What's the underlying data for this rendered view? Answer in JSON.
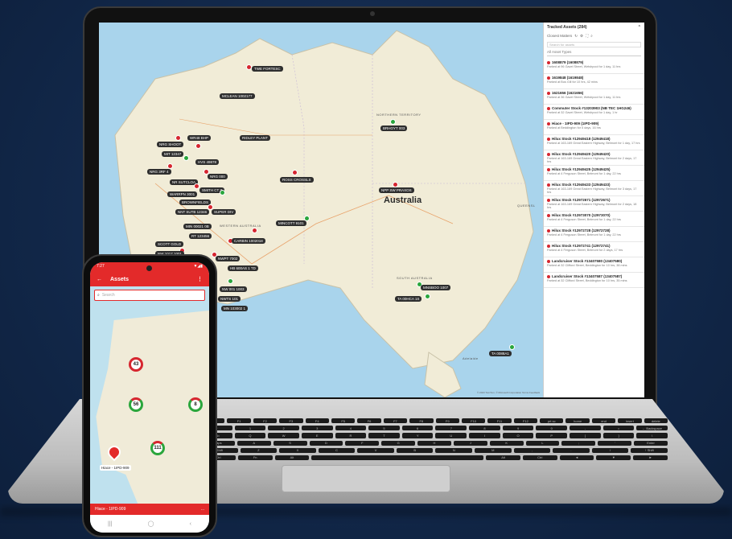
{
  "laptop": {
    "map": {
      "country_label": "Australia",
      "places": [
        {
          "id": "northern-territory",
          "label": "NORTHERN TERRITORY"
        },
        {
          "id": "western-australia",
          "label": "WESTERN AUSTRALIA"
        },
        {
          "id": "south-australia",
          "label": "SOUTH AUSTRALIA"
        },
        {
          "id": "queensland",
          "label": "QUEENSL"
        },
        {
          "id": "adelaide",
          "label": "Adelaide"
        }
      ],
      "cluster_labels": [
        "TWE FORTESC",
        "MCLEAN 1002177",
        "BRHOYT 003",
        "NRG SHOOT",
        "WR48 BHP",
        "MIT 12347",
        "HVS 49878",
        "NRG 3RF 4",
        "NRG 000",
        "NR SUTCLOA",
        "SMITH CT 7",
        "WARRPN 3001",
        "BROWNFIELDS",
        "RIDLEY PLANT",
        "NNT SUTB 12346",
        "SUPER DIV",
        "ROSS CROSSLS",
        "MINCOTT 9101",
        "MIN 00021 0B",
        "RT 123456",
        "CARBIN 1002018",
        "SCOTT GOLD",
        "NW 1017 1001",
        "NWPT 7002",
        "NW 1007",
        "HB 600AS 1 TD",
        "NPP SW PRAXOS",
        "NW 001 1003",
        "NWTS 101",
        "MN 103002 1",
        "MNSBOO 1007",
        "TA 00HCA 1S",
        "TA 0088A1",
        "BG BA 7001",
        "LAVERTON 1",
        "NORTHERNS",
        "CROS DD CHUTE",
        "SN CORLOC 13",
        "SWPT 1",
        "SW ALBION",
        "PERTH ALBANY",
        "EX BASIN ENGIN",
        "SOUTHERN CROSS"
      ],
      "footer": "© 2023 TomTom, © Microsoft Corporation  Terms  Feedback"
    },
    "panel": {
      "title": "Tracked Assets (284)",
      "sort_label": "Closest Matters",
      "search_placeholder": "Search for assets",
      "filter_label": "All Asset Types",
      "assets": [
        {
          "title": "1608879 (1608879)",
          "sub": "Parked at 96 Gavel Street, Welshpool for 1 day, 11 hrs"
        },
        {
          "title": "1619848 (1619848)",
          "sub": "Parked at Bus Gill for 10 hrs, 42 mins"
        },
        {
          "title": "1621656 (1621656)",
          "sub": "Parked at 36 Gavel Street, Welshpool for 1 day, 11 hrs"
        },
        {
          "title": "Commuter Stock #13203903 (NB TEC 1HG246)",
          "sub": "Parked at 32 Gavel Street, Welshpool for 1 day, 1 hr"
        },
        {
          "title": "Hiace - 1IPD-909 (1IPD-909)",
          "sub": "Parked at Beddington for 5 days, 16 hrs"
        },
        {
          "title": "Hilux Stock #12949418 (12949418)",
          "sub": "Parked at 163-169 Great Eastern Highway, Belmont for 1 day, 17 hrs"
        },
        {
          "title": "Hilux Stock #12949420 (12949420)",
          "sub": "Parked at 163-169 Great Eastern Highway, Belmont for 2 days, 17 hrs"
        },
        {
          "title": "Hilux Stock #12949425 (12949425)",
          "sub": "Parked at 4 Ferguson Street, Belmont for 1 day, 22 hrs"
        },
        {
          "title": "Hilux Stock #12949433 (12949433)",
          "sub": "Parked at 163-169 Great Eastern Highway, Belmont for 3 days, 17 hrs"
        },
        {
          "title": "Hilux Stock #12972671 (12972671)",
          "sub": "Parked at 163-169 Great Eastern Highway, Belmont for 2 days, 18 hrs"
        },
        {
          "title": "Hilux Stock #12973070 (12973070)",
          "sub": "Parked at 4 Ferguson Street, Belmont for 1 day, 22 hrs"
        },
        {
          "title": "Hilux Stock #12972728 (12972728)",
          "sub": "Parked at 4 Ferguson Street, Belmont for 1 day, 22 hrs"
        },
        {
          "title": "Hilux Stock #12972741 (12972741)",
          "sub": "Parked at 4 Ferguson Street, Belmont for 2 days, 17 hrs"
        },
        {
          "title": "Landcruiser Stock #13407580 (13407580)",
          "sub": "Parked at 32 Clifford Street, Beddington for 10 hrs, 38 mins"
        },
        {
          "title": "Landcruiser Stock #13407587 (13407587)",
          "sub": "Parked at 32 Clifford Street, Beddington for 10 hrs, 35 mins"
        }
      ]
    },
    "keyboard": {
      "row1": [
        "esc",
        "F1",
        "F2",
        "F3",
        "F4",
        "F5",
        "F6",
        "F7",
        "F8",
        "F9",
        "F10",
        "F11",
        "F12",
        "prt sc",
        "home",
        "end",
        "insert",
        "delete"
      ],
      "row2": [
        "~",
        "1",
        "2",
        "3",
        "4",
        "5",
        "6",
        "7",
        "8",
        "9",
        "0",
        "-",
        "=",
        "← Backspace"
      ],
      "row3": [
        "Tab",
        "Q",
        "W",
        "E",
        "R",
        "T",
        "Y",
        "U",
        "I",
        "O",
        "P",
        "[",
        "]",
        "\\"
      ],
      "row4": [
        "Caps",
        "A",
        "S",
        "D",
        "F",
        "G",
        "H",
        "J",
        "K",
        "L",
        ";",
        "'",
        "Enter"
      ],
      "row5": [
        "Shift",
        "Z",
        "X",
        "C",
        "V",
        "B",
        "N",
        "M",
        ",",
        ".",
        "/",
        "↑ Shift"
      ],
      "row6": [
        "Ctrl",
        "Fn",
        "Alt",
        "",
        "Alt",
        "Ctrl",
        "◄",
        "▼",
        "►"
      ]
    }
  },
  "phone": {
    "status_time": "7:27",
    "status_icons": "▼◢▮",
    "appbar_title": "Assets",
    "search_placeholder": "Search",
    "clusters": [
      {
        "id": "north",
        "count": "43"
      },
      {
        "id": "mid",
        "count": "56"
      },
      {
        "id": "east",
        "count": "8"
      },
      {
        "id": "south",
        "count": "111"
      }
    ],
    "selected_pin_label": "Hiace - 1IPD-909",
    "bottom_bar_label": "Hiace - 1IPD-909",
    "bottom_bar_action": "..."
  },
  "colors": {
    "brand_red": "#e32a2a",
    "pin_red": "#d6262f",
    "pin_green": "#2aa63c",
    "background": "#12284a"
  }
}
